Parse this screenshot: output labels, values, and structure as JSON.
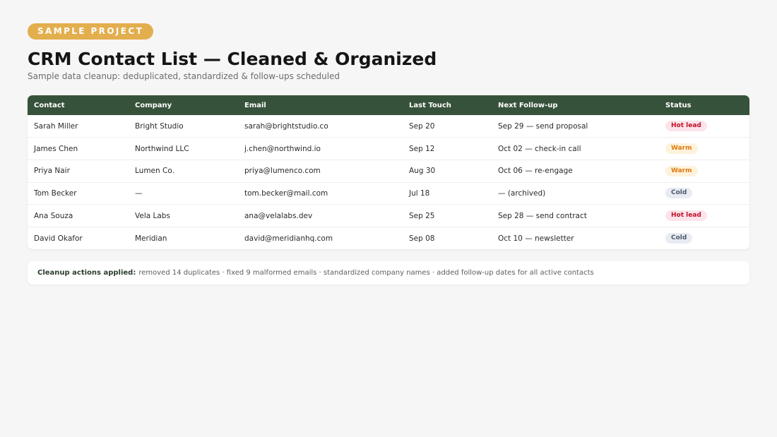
{
  "header": {
    "badge": "SAMPLE PROJECT",
    "title": "CRM Contact List — Cleaned & Organized",
    "subtitle": "Sample data cleanup: deduplicated, standardized & follow-ups scheduled"
  },
  "table": {
    "columns": [
      "Contact",
      "Company",
      "Email",
      "Last Touch",
      "Next Follow-up",
      "Status"
    ],
    "rows": [
      {
        "contact": "Sarah Miller",
        "company": "Bright Studio",
        "email": "sarah@brightstudio.co",
        "last_touch": "Sep 20",
        "next_follow_up": "Sep 29 — send proposal",
        "status": "Hot lead",
        "status_kind": "hot"
      },
      {
        "contact": "James Chen",
        "company": "Northwind LLC",
        "email": "j.chen@northwind.io",
        "last_touch": "Sep 12",
        "next_follow_up": "Oct 02 — check-in call",
        "status": "Warm",
        "status_kind": "warm"
      },
      {
        "contact": "Priya Nair",
        "company": "Lumen Co.",
        "email": "priya@lumenco.com",
        "last_touch": "Aug 30",
        "next_follow_up": "Oct 06 — re-engage",
        "status": "Warm",
        "status_kind": "warm"
      },
      {
        "contact": "Tom Becker",
        "company": "—",
        "email": "tom.becker@mail.com",
        "last_touch": "Jul 18",
        "next_follow_up": "— (archived)",
        "status": "Cold",
        "status_kind": "cold"
      },
      {
        "contact": "Ana Souza",
        "company": "Vela Labs",
        "email": "ana@velalabs.dev",
        "last_touch": "Sep 25",
        "next_follow_up": "Sep 28 — send contract",
        "status": "Hot lead",
        "status_kind": "hot"
      },
      {
        "contact": "David Okafor",
        "company": "Meridian",
        "email": "david@meridianhq.com",
        "last_touch": "Sep 08",
        "next_follow_up": "Oct 10 — newsletter",
        "status": "Cold",
        "status_kind": "cold"
      }
    ]
  },
  "notes": {
    "lead": "Cleanup actions applied:",
    "text": "removed 14 duplicates · fixed 9 malformed emails · standardized company names · added follow-up dates for all active contacts"
  },
  "colors": {
    "badge": "#e3ae4e",
    "header_row": "#37523a",
    "hot": "#c0102a",
    "warm": "#e07a10",
    "cold": "#4d5a6c"
  }
}
